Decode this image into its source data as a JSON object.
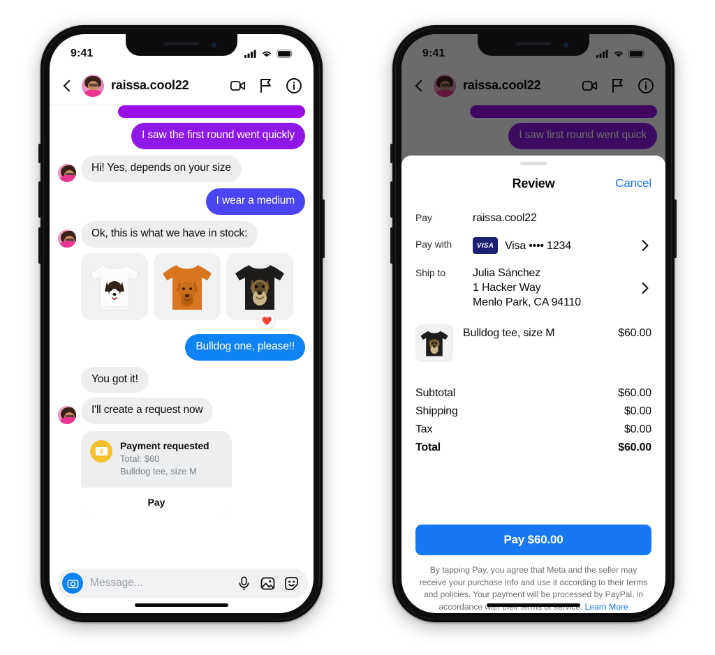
{
  "status_bar": {
    "time": "9:41",
    "signal_icon": "cellular-bars-icon",
    "wifi_icon": "wifi-icon",
    "battery_icon": "battery-icon"
  },
  "chat_header": {
    "back_icon": "back-chevron-icon",
    "username": "raissa.cool22",
    "avatar": "avatar",
    "video_icon": "video-camera-icon",
    "flag_icon": "flag-icon",
    "info_icon": "info-circle-icon"
  },
  "conversation": {
    "messages": [
      {
        "id": "m0",
        "side": "out",
        "text": "",
        "color": "#9a0fe8",
        "clipped": true
      },
      {
        "id": "m1",
        "side": "out",
        "text": "I saw the first round went quickly",
        "color": "#9a0fe8"
      },
      {
        "id": "m2",
        "side": "in",
        "text": "Hi! Yes, depends on your size",
        "avatar": true
      },
      {
        "id": "m3",
        "side": "out",
        "text": "I wear a medium",
        "color": "#4a44f2"
      },
      {
        "id": "m4",
        "side": "in",
        "text": "Ok, this is what we have in stock:",
        "avatar": true
      },
      {
        "id": "m5",
        "side": "out",
        "text": "Bulldog one, please!!",
        "color": "#0f82f5"
      },
      {
        "id": "m6",
        "side": "in",
        "text": "You got it!",
        "avatar": false
      },
      {
        "id": "m7",
        "side": "in",
        "text": "I'll create a request now",
        "avatar": true
      }
    ],
    "products": [
      {
        "name": "border-collie-tee",
        "shirt_color": "#f7f7f7",
        "label": "White tee with border collie print"
      },
      {
        "name": "golden-retriever-tee",
        "shirt_color": "#d9761f",
        "label": "Orange tee with golden retriever print"
      },
      {
        "name": "bulldog-tee",
        "shirt_color": "#1d1c1a",
        "label": "Black tee with bulldog print"
      }
    ],
    "reaction": {
      "emoji": "❤️",
      "icon": "heart-reaction-icon",
      "on_product": "bulldog-tee"
    },
    "payment_request": {
      "icon": "money-coin-icon",
      "title": "Payment requested",
      "total_line": "Total: $60",
      "item_line": "Bulldog tee, size M",
      "action_label": "Pay"
    }
  },
  "composer": {
    "camera_icon": "camera-icon",
    "placeholder": "Message...",
    "value": "",
    "mic_icon": "microphone-icon",
    "gallery_icon": "photo-gallery-icon",
    "sticker_icon": "sticker-smiley-icon"
  },
  "right_phone": {
    "dim_messages": [
      {
        "id": "d0",
        "text": "",
        "clipped": true
      },
      {
        "id": "d1",
        "text": "I saw first round went quick"
      }
    ],
    "sheet": {
      "grabber": "sheet-grabber",
      "title": "Review",
      "cancel_label": "Cancel",
      "rows": [
        {
          "label": "Pay",
          "value": "raissa.cool22",
          "chevron": false
        },
        {
          "label": "Pay with",
          "value": "Visa •••• 1234",
          "brand": "VISA",
          "chevron": true
        },
        {
          "label": "Ship to",
          "value": "Julia Sánchez\n1 Hacker Way\nMenlo Park, CA 94110",
          "chevron": true
        }
      ],
      "line_item": {
        "thumb": "bulldog-tee-thumbnail",
        "name": "Bulldog tee, size M",
        "price": "$60.00"
      },
      "totals": [
        {
          "label": "Subtotal",
          "value": "$60.00",
          "bold": false
        },
        {
          "label": "Shipping",
          "value": "$0.00",
          "bold": false
        },
        {
          "label": "Tax",
          "value": "$0.00",
          "bold": false
        },
        {
          "label": "Total",
          "value": "$60.00",
          "bold": true
        }
      ],
      "pay_button_label": "Pay $60.00",
      "disclaimer": "By tapping Pay, you agree that Meta and the seller may receive your purchase info and use it according to their terms and policies. Your payment will be processed by PayPal, in accordance with their terms of service.",
      "learn_more_label": "Learn More"
    }
  },
  "colors": {
    "purple": "#9a0fe8",
    "indigo": "#4a44f2",
    "blue": "#0f82f5",
    "link_blue": "#1877f2",
    "bubble_gray": "#eceef0",
    "coin_yellow": "#f8c12c",
    "visa_navy": "#1a1f71",
    "heart_red": "#ed2a3c"
  }
}
